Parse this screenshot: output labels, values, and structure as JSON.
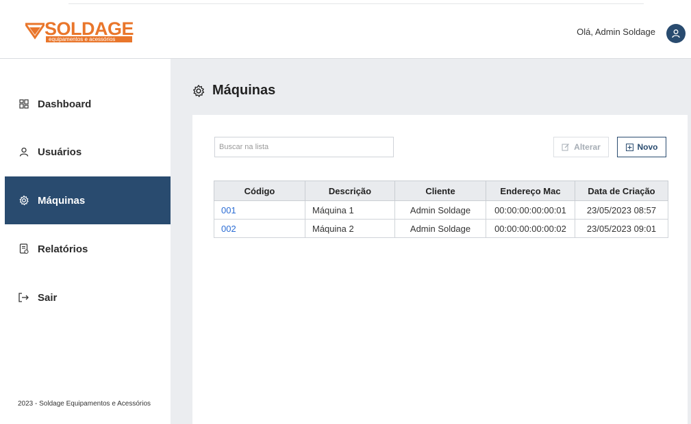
{
  "header": {
    "logo_text": "SOLDAGE",
    "logo_tagline": "equipamentos e acessórios",
    "greeting": "Olá, Admin Soldage",
    "avatar_icon": "user-icon"
  },
  "sidebar": {
    "items": [
      {
        "label": "Dashboard",
        "icon": "dashboard-icon"
      },
      {
        "label": "Usuários",
        "icon": "user-icon"
      },
      {
        "label": "Máquinas",
        "icon": "gear-icon",
        "active": true
      },
      {
        "label": "Relatórios",
        "icon": "report-icon"
      },
      {
        "label": "Sair",
        "icon": "logout-icon"
      }
    ],
    "footer": "2023 - Soldage Equipamentos e Acessórios"
  },
  "page": {
    "title": "Máquinas",
    "title_icon": "gear-icon"
  },
  "toolbar": {
    "search_placeholder": "Buscar na lista",
    "alterar_label": "Alterar",
    "novo_label": "Novo"
  },
  "table": {
    "columns": [
      "Código",
      "Descrição",
      "Cliente",
      "Endereço Mac",
      "Data de Criação"
    ],
    "rows": [
      [
        "001",
        "Máquina 1",
        "Admin Soldage",
        "00:00:00:00:00:01",
        "23/05/2023 08:57"
      ],
      [
        "002",
        "Máquina 2",
        "Admin Soldage",
        "00:00:00:00:00:02",
        "23/05/2023 09:01"
      ]
    ]
  },
  "colors": {
    "brand_orange": "#e9762b",
    "brand_navy": "#294b6f",
    "link_blue": "#2a6cd4",
    "background": "#ebedf0"
  }
}
